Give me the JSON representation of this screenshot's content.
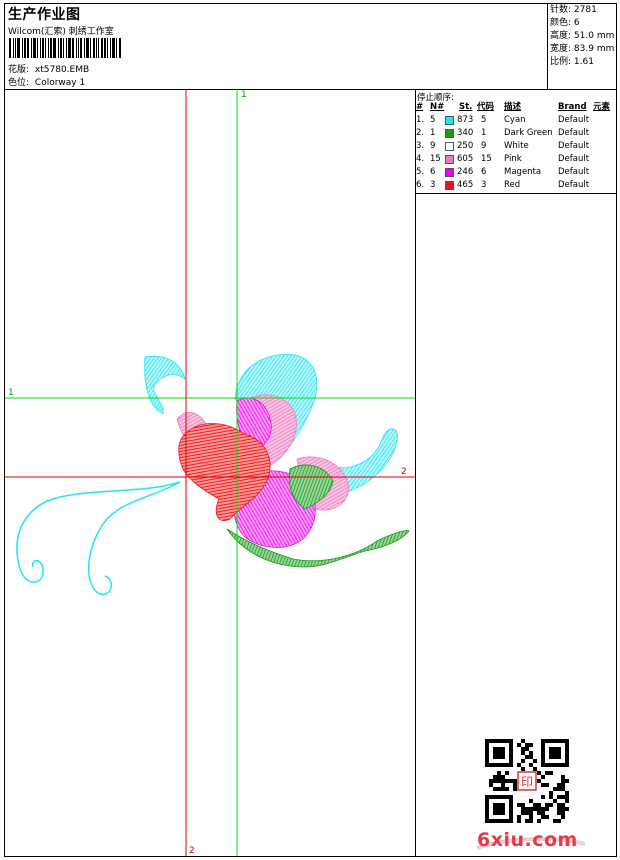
{
  "header": {
    "title": "生产作业图",
    "subtitle": "Wilcom(汇索) 刺绣工作室",
    "design_label": "花版:",
    "design_value": "xt5780.EMB",
    "colorway_label": "色位:",
    "colorway_value": "Colorway 1"
  },
  "stats": [
    {
      "label": "针数:",
      "value": "2781"
    },
    {
      "label": "颜色:",
      "value": "6"
    },
    {
      "label": "高度:",
      "value": "51.0 mm"
    },
    {
      "label": "宽度:",
      "value": "83.9 mm"
    },
    {
      "label": "比例:",
      "value": "1.61"
    }
  ],
  "guides": {
    "h1_label": "1",
    "h2_label": "2",
    "v1_label": "1",
    "v2_label": "2",
    "green_color": "#00e000",
    "red_color": "#e00000"
  },
  "stop_sequence": {
    "heading": "停止顺序:",
    "columns": [
      "#",
      "N#",
      "St.",
      "代码",
      "描述",
      "Brand",
      "元素"
    ],
    "rows": [
      {
        "idx": "1.",
        "n": "5",
        "stitches": "873",
        "code": "5",
        "desc": "Cyan",
        "brand": "Default",
        "color": "#22e6f0"
      },
      {
        "idx": "2.",
        "n": "1",
        "stitches": "340",
        "code": "1",
        "desc": "Dark Green",
        "brand": "Default",
        "color": "#1a9a1a"
      },
      {
        "idx": "3.",
        "n": "9",
        "stitches": "250",
        "code": "9",
        "desc": "White",
        "brand": "Default",
        "color": "#ffffff"
      },
      {
        "idx": "4.",
        "n": "15",
        "stitches": "605",
        "code": "15",
        "desc": "Pink",
        "brand": "Default",
        "color": "#f07ac0"
      },
      {
        "idx": "5.",
        "n": "6",
        "stitches": "246",
        "code": "6",
        "desc": "Magenta",
        "brand": "Default",
        "color": "#f000f0"
      },
      {
        "idx": "6.",
        "n": "3",
        "stitches": "465",
        "code": "3",
        "desc": "Red",
        "brand": "Default",
        "color": "#f01010"
      }
    ]
  },
  "watermark": {
    "text": "6xiu.com",
    "seal_text": "印"
  }
}
